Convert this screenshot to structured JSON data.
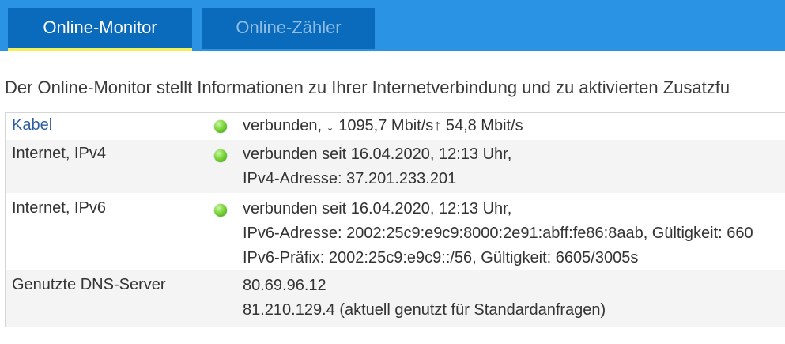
{
  "tabs": [
    {
      "label": "Online-Monitor",
      "active": true
    },
    {
      "label": "Online-Zähler",
      "active": false
    }
  ],
  "intro_text": "Der Online-Monitor stellt Informationen zu Ihrer Internetverbindung und zu aktivierten Zusatzfu",
  "rows": [
    {
      "label": "Kabel",
      "status": "green",
      "lines": [
        "verbunden, ↓ 1095,7 Mbit/s↑ 54,8 Mbit/s"
      ]
    },
    {
      "label": "Internet, IPv4",
      "status": "green",
      "lines": [
        "verbunden seit 16.04.2020, 12:13 Uhr,",
        "IPv4-Adresse: 37.201.233.201"
      ]
    },
    {
      "label": "Internet, IPv6",
      "status": "green",
      "lines": [
        "verbunden seit 16.04.2020, 12:13 Uhr,",
        "IPv6-Adresse: 2002:25c9:e9c9:8000:2e91:abff:fe86:8aab, Gültigkeit: 660",
        "IPv6-Präfix: 2002:25c9:e9c9::/56, Gültigkeit: 6605/3005s"
      ]
    },
    {
      "label": "Genutzte DNS-Server",
      "status": null,
      "lines": [
        "80.69.96.12",
        "81.210.129.4 (aktuell genutzt für Standardanfragen)"
      ]
    }
  ],
  "colors": {
    "tabbar": "#2b93e3",
    "tab": "#0a6bbd",
    "active_underline": "#f3f05a",
    "link": "#2d5f9e",
    "status_green": "#7cd63a"
  }
}
